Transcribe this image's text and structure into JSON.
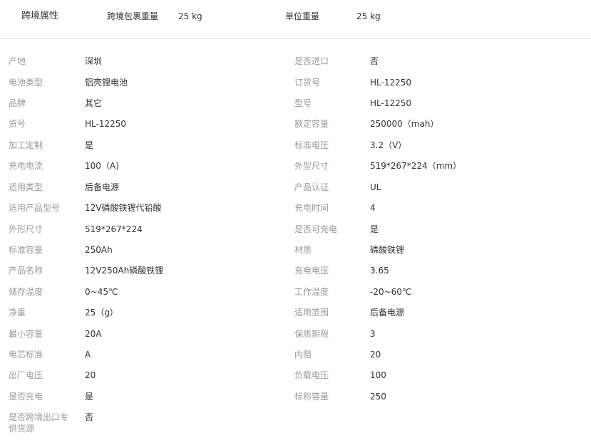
{
  "header": {
    "section_title": "跨境属性",
    "fields": [
      {
        "label": "跨境包裹重量",
        "value": "25 kg"
      },
      {
        "label": "单位重量",
        "value": "25 kg"
      }
    ]
  },
  "attributes_left": [
    {
      "label": "产地",
      "value": "深圳"
    },
    {
      "label": "电池类型",
      "value": "铝壳锂电池"
    },
    {
      "label": "品牌",
      "value": "其它"
    },
    {
      "label": "货号",
      "value": "HL-12250"
    },
    {
      "label": "加工定制",
      "value": "是"
    },
    {
      "label": "充电电流",
      "value": "100（A)"
    },
    {
      "label": "适用类型",
      "value": "后备电源"
    },
    {
      "label": "适用产品型号",
      "value": "12V磷酸铁锂代铅酸"
    },
    {
      "label": "外形尺寸",
      "value": "519*267*224"
    },
    {
      "label": "标准容量",
      "value": "250Ah"
    },
    {
      "label": "产品名称",
      "value": "12V250Ah磷酸铁锂"
    },
    {
      "label": "储存温度",
      "value": "0~45℃"
    },
    {
      "label": "净重",
      "value": "25（g）"
    },
    {
      "label": "最小容量",
      "value": "20A"
    },
    {
      "label": "电芯标准",
      "value": "A"
    },
    {
      "label": "出厂电压",
      "value": "20"
    },
    {
      "label": "是否充电",
      "value": "是"
    },
    {
      "label": "是否跨境出口专供货源",
      "value": "否"
    }
  ],
  "attributes_right": [
    {
      "label": "是否进口",
      "value": "否"
    },
    {
      "label": "订货号",
      "value": "HL-12250"
    },
    {
      "label": "型号",
      "value": "HL-12250"
    },
    {
      "label": "额定容量",
      "value": "250000（mah）"
    },
    {
      "label": "标准电压",
      "value": "3.2（V）"
    },
    {
      "label": "外型尺寸",
      "value": "519*267*224（mm）"
    },
    {
      "label": "产品认证",
      "value": "UL"
    },
    {
      "label": "充电时间",
      "value": "4"
    },
    {
      "label": "是否可充电",
      "value": "是"
    },
    {
      "label": "材质",
      "value": "磷酸铁锂"
    },
    {
      "label": "充电电压",
      "value": "3.65"
    },
    {
      "label": "工作温度",
      "value": "-20~60℃"
    },
    {
      "label": "适用范围",
      "value": "后备电源"
    },
    {
      "label": "保质期限",
      "value": "3"
    },
    {
      "label": "内阻",
      "value": "20"
    },
    {
      "label": "负载电压",
      "value": "100"
    },
    {
      "label": "标称容量",
      "value": "250"
    }
  ]
}
